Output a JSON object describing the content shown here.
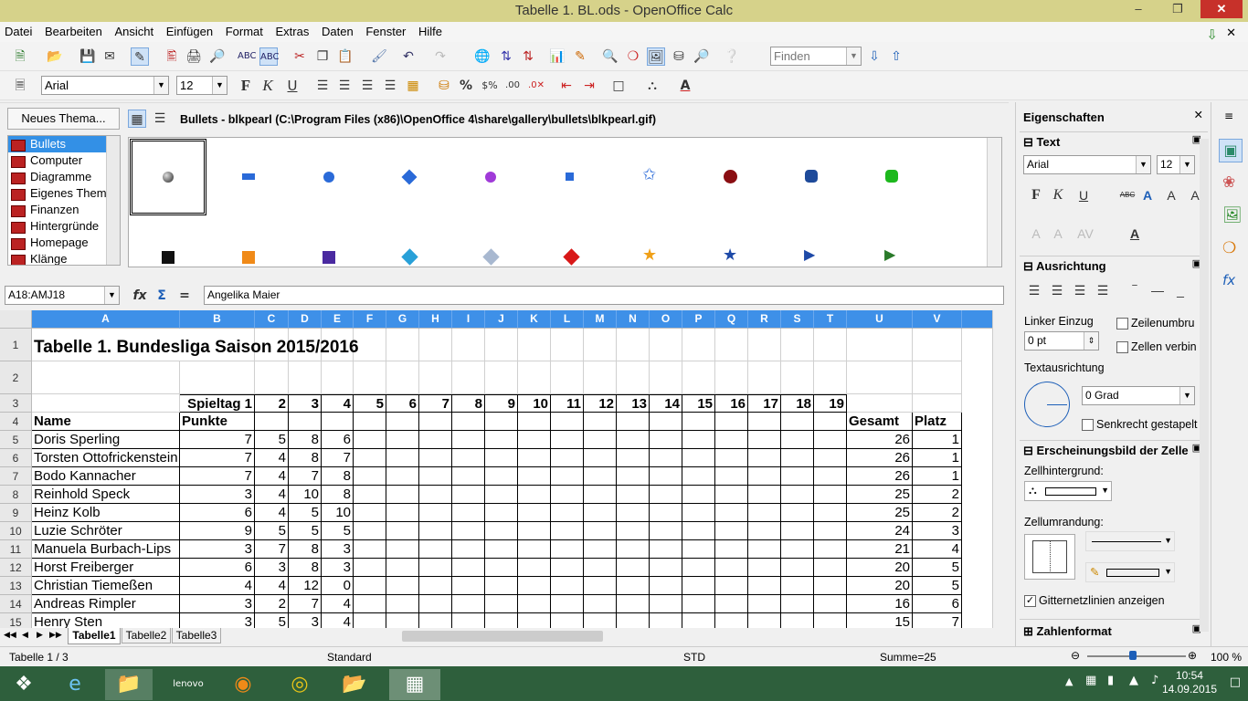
{
  "window": {
    "title": "Tabelle 1. BL.ods - OpenOffice Calc"
  },
  "menu": [
    "Datei",
    "Bearbeiten",
    "Ansicht",
    "Einfügen",
    "Format",
    "Extras",
    "Daten",
    "Fenster",
    "Hilfe"
  ],
  "toolbar": {
    "find_placeholder": "Finden",
    "font_name": "Arial",
    "font_size": "12"
  },
  "gallery": {
    "new_theme_label": "Neues Thema...",
    "path": "Bullets - blkpearl (C:\\Program Files (x86)\\OpenOffice 4\\share\\gallery\\bullets\\blkpearl.gif)",
    "themes": [
      "Bullets",
      "Computer",
      "Diagramme",
      "Eigenes Thema",
      "Finanzen",
      "Hintergründe",
      "Homepage",
      "Klänge"
    ],
    "selected_theme": "Bullets"
  },
  "formula": {
    "name_box": "A18:AMJ18",
    "content": "Angelika Maier"
  },
  "columns": [
    "A",
    "B",
    "C",
    "D",
    "E",
    "F",
    "G",
    "H",
    "I",
    "J",
    "K",
    "L",
    "M",
    "N",
    "O",
    "P",
    "Q",
    "R",
    "S",
    "T",
    "U",
    "V"
  ],
  "row_numbers": [
    "1",
    "2",
    "3",
    "4",
    "5",
    "6",
    "7",
    "8",
    "9",
    "10",
    "11",
    "12",
    "13",
    "14",
    "15"
  ],
  "sheet": {
    "title": "Tabelle 1. Bundesliga Saison 2015/2016",
    "spieltag_label": "Spieltag 1",
    "spieltage": [
      "2",
      "3",
      "4",
      "5",
      "6",
      "7",
      "8",
      "9",
      "10",
      "11",
      "12",
      "13",
      "14",
      "15",
      "16",
      "17",
      "18",
      "19"
    ],
    "name_header": "Name",
    "punkte_header": "Punkte",
    "gesamt_header": "Gesamt",
    "platz_header": "Platz",
    "players": [
      {
        "name": "Doris Sperling",
        "b": "7",
        "c": "5",
        "d": "8",
        "e": "6",
        "gesamt": "26",
        "platz": "1"
      },
      {
        "name": "Torsten Ottofrickenstein",
        "b": "7",
        "c": "4",
        "d": "8",
        "e": "7",
        "gesamt": "26",
        "platz": "1"
      },
      {
        "name": "Bodo Kannacher",
        "b": "7",
        "c": "4",
        "d": "7",
        "e": "8",
        "gesamt": "26",
        "platz": "1"
      },
      {
        "name": "Reinhold Speck",
        "b": "3",
        "c": "4",
        "d": "10",
        "e": "8",
        "gesamt": "25",
        "platz": "2"
      },
      {
        "name": "Heinz Kolb",
        "b": "6",
        "c": "4",
        "d": "5",
        "e": "10",
        "gesamt": "25",
        "platz": "2"
      },
      {
        "name": "Luzie Schröter",
        "b": "9",
        "c": "5",
        "d": "5",
        "e": "5",
        "gesamt": "24",
        "platz": "3"
      },
      {
        "name": "Manuela Burbach-Lips",
        "b": "3",
        "c": "7",
        "d": "8",
        "e": "3",
        "gesamt": "21",
        "platz": "4"
      },
      {
        "name": "Horst Freiberger",
        "b": "6",
        "c": "3",
        "d": "8",
        "e": "3",
        "gesamt": "20",
        "platz": "5"
      },
      {
        "name": "Christian Tiemeßen",
        "b": "4",
        "c": "4",
        "d": "12",
        "e": "0",
        "gesamt": "20",
        "platz": "5"
      },
      {
        "name": "Andreas Rimpler",
        "b": "3",
        "c": "2",
        "d": "7",
        "e": "4",
        "gesamt": "16",
        "platz": "6"
      },
      {
        "name": "Henry Sten",
        "b": "3",
        "c": "5",
        "d": "3",
        "e": "4",
        "gesamt": "15",
        "platz": "7"
      }
    ]
  },
  "tabs": [
    "Tabelle1",
    "Tabelle2",
    "Tabelle3"
  ],
  "status": {
    "sheet_pos": "Tabelle 1 / 3",
    "style": "Standard",
    "mode": "STD",
    "sum": "Summe=25",
    "zoom": "100 %"
  },
  "sidebar": {
    "title": "Eigenschaften",
    "text_section": "Text",
    "font_name": "Arial",
    "font_size": "12",
    "align_section": "Ausrichtung",
    "indent_label": "Linker Einzug",
    "indent_value": "0 pt",
    "wrap_label": "Zeilenumbru",
    "merge_label": "Zellen verbin",
    "orientation_label": "Textausrichtung",
    "degree_value": "0 Grad",
    "vertical_label": "Senkrecht gestapelt",
    "cell_section": "Erscheinungsbild der Zelle",
    "bg_label": "Zellhintergrund:",
    "border_label": "Zellumrandung:",
    "grid_label": "Gitternetzlinien anzeigen",
    "number_section": "Zahlenformat"
  },
  "clock": {
    "time": "10:54",
    "date": "14.09.2015"
  },
  "colors": {
    "accent": "#3e90e8",
    "titlebar": "#d6d28a",
    "taskbar": "#2e5f3c"
  }
}
